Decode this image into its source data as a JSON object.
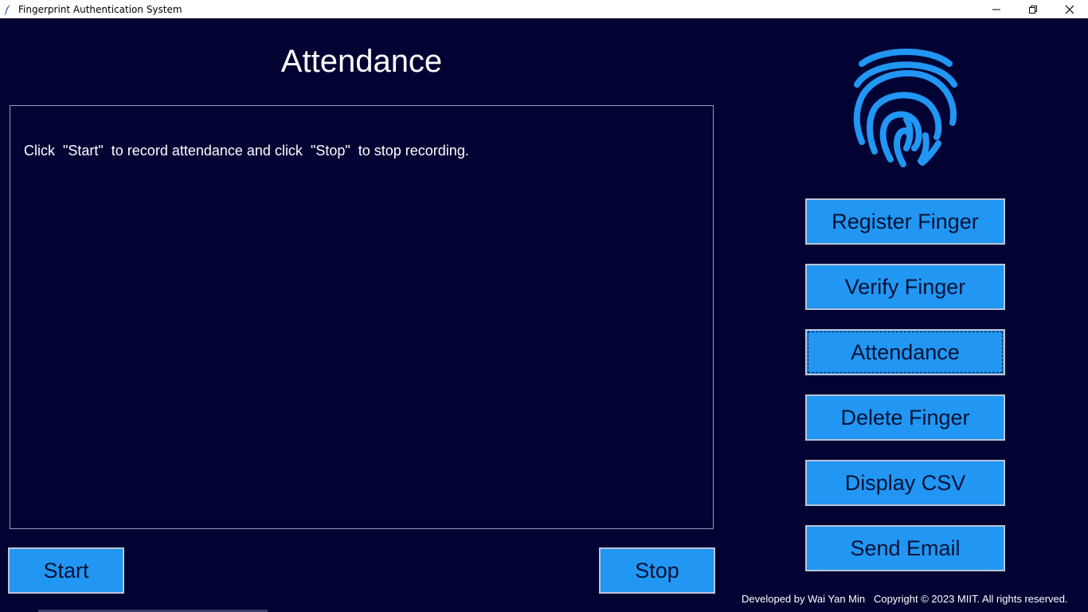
{
  "window": {
    "title": "Fingerprint Authentication System",
    "icon": "feather-icon",
    "controls": [
      "minimize-icon",
      "restore-icon",
      "close-icon"
    ]
  },
  "main": {
    "title": "Attendance",
    "log_text": "Click  \"Start\"  to record attendance and click  \"Stop\"  to stop recording.",
    "start_label": "Start",
    "stop_label": "Stop"
  },
  "sidebar": {
    "logo": "fingerprint-icon",
    "buttons": [
      {
        "label": "Register Finger"
      },
      {
        "label": "Verify Finger"
      },
      {
        "label": "Attendance"
      },
      {
        "label": "Delete Finger"
      },
      {
        "label": "Display CSV"
      },
      {
        "label": "Send Email"
      }
    ]
  },
  "footer": {
    "text": "Developed by Wai Yan Min   Copyright © 2023 MIIT. All rights reserved."
  },
  "colors": {
    "background": "#020333",
    "button": "#2196f3",
    "accent": "#2196f3",
    "text": "#ffffff"
  }
}
